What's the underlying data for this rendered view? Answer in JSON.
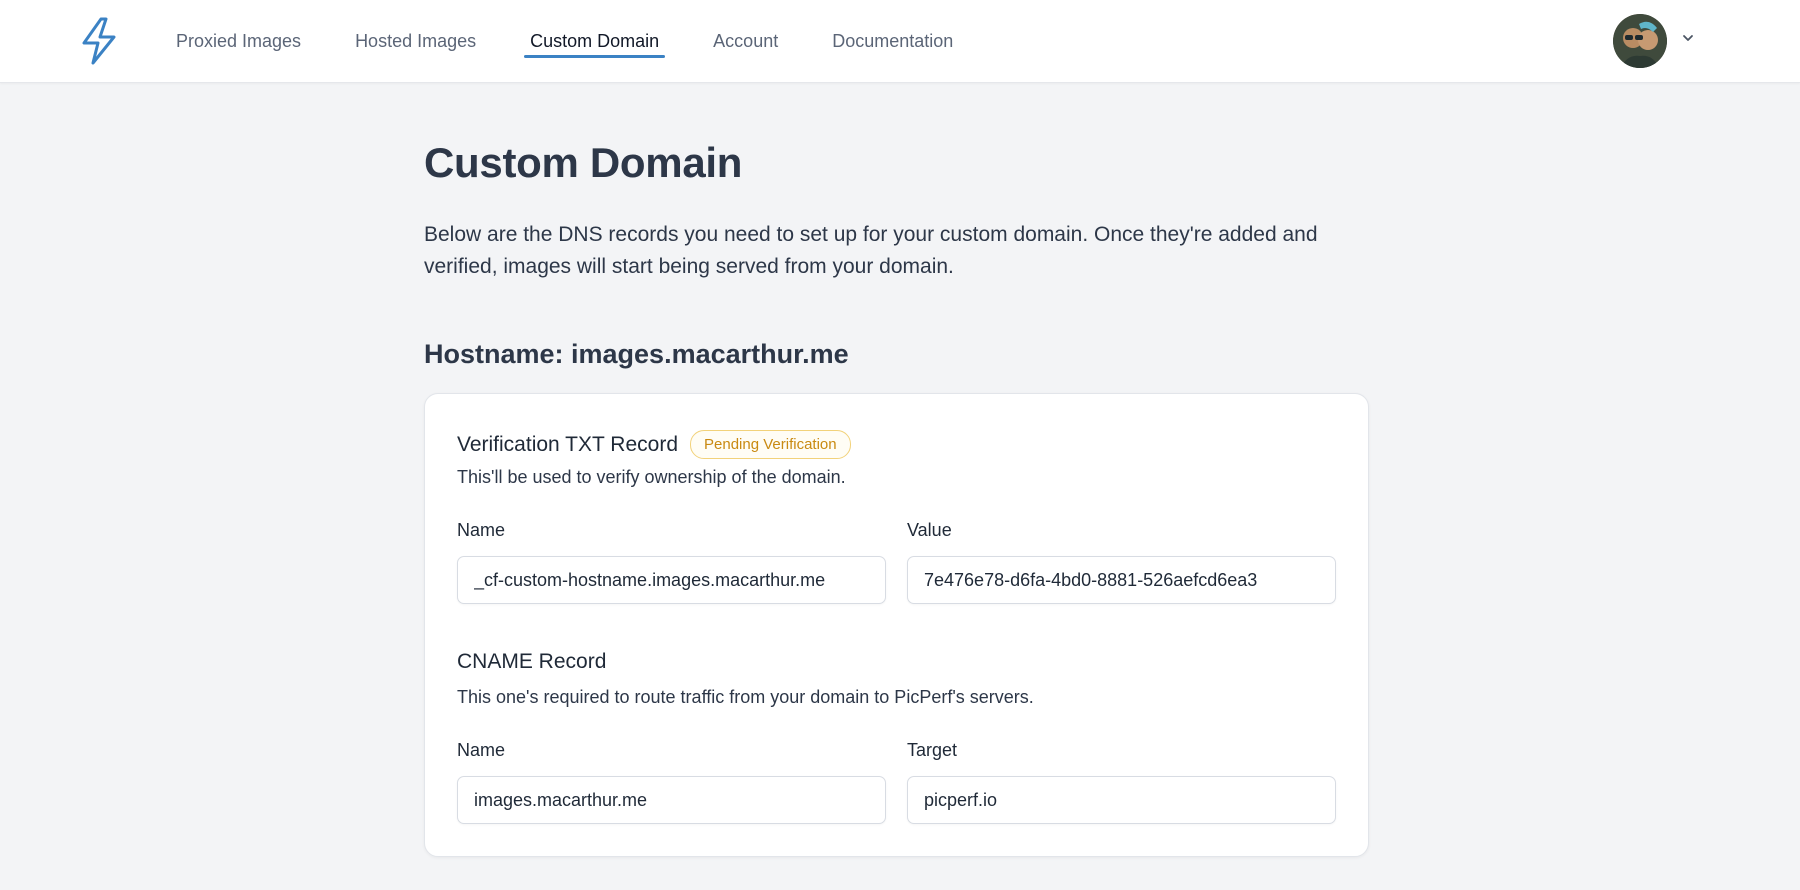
{
  "nav": {
    "items": [
      {
        "label": "Proxied Images"
      },
      {
        "label": "Hosted Images"
      },
      {
        "label": "Custom Domain"
      },
      {
        "label": "Account"
      },
      {
        "label": "Documentation"
      }
    ],
    "active_index": 2
  },
  "colors": {
    "accent": "#3b82c4",
    "badge_text": "#c98a12",
    "badge_border": "#f2d27a",
    "background": "#f3f4f6"
  },
  "icons": {
    "logo": "lightning-bolt-icon",
    "account_menu": "chevron-down-icon"
  },
  "page": {
    "title": "Custom Domain",
    "intro": "Below are the DNS records you need to set up for your custom domain. Once they're added and verified, images will start being served from your domain.",
    "hostname_label": "Hostname: images.macarthur.me"
  },
  "verification": {
    "title": "Verification TXT Record",
    "badge": "Pending Verification",
    "description": "This'll be used to verify ownership of the domain.",
    "name_label": "Name",
    "name_value": "_cf-custom-hostname.images.macarthur.me",
    "value_label": "Value",
    "value_value": "7e476e78-d6fa-4bd0-8881-526aefcd6ea3"
  },
  "cname": {
    "title": "CNAME Record",
    "description": "This one's required to route traffic from your domain to PicPerf's servers.",
    "name_label": "Name",
    "name_value": "images.macarthur.me",
    "target_label": "Target",
    "target_value": "picperf.io"
  }
}
